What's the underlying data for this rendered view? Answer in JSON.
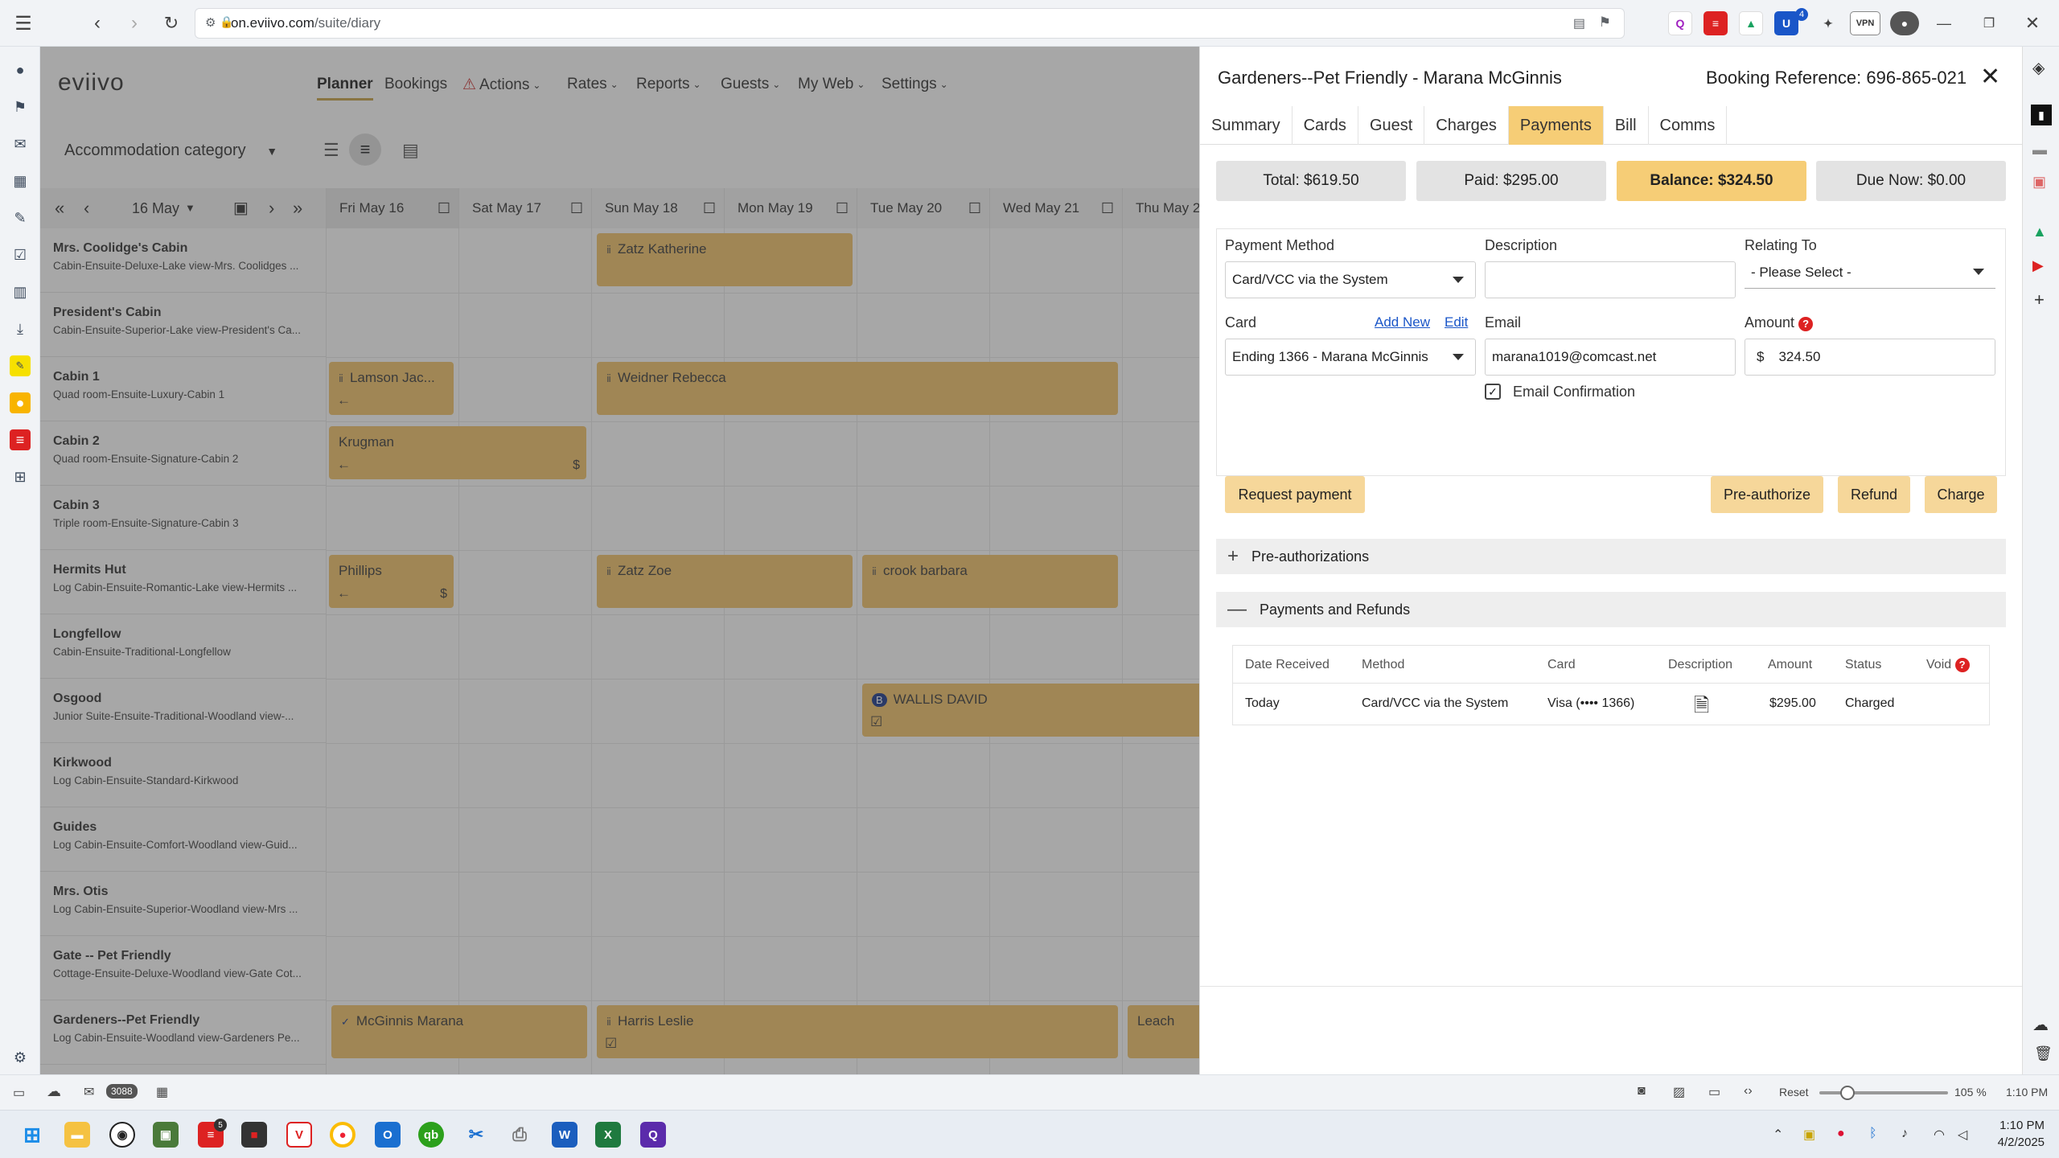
{
  "browser": {
    "url_host": "on.eviivo.com",
    "url_path": "/suite/diary",
    "vpn_label": "VPN",
    "badge_count": "4"
  },
  "app": {
    "logo": "eviivo",
    "nav": {
      "planner": "Planner",
      "bookings": "Bookings",
      "actions": "Actions",
      "rates": "Rates",
      "reports": "Reports",
      "guests": "Guests",
      "myweb": "My Web",
      "settings": "Settings"
    },
    "category_select": "Accommodation category",
    "date_select": "16 May",
    "days": [
      "Fri May 16",
      "Sat May 17",
      "Sun May 18",
      "Mon May 19",
      "Tue May 20",
      "Wed May 21",
      "Thu May 2"
    ],
    "rooms": [
      {
        "name": "Mrs. Coolidge's Cabin",
        "desc": "Cabin-Ensuite-Deluxe-Lake view-Mrs. Coolidges ..."
      },
      {
        "name": "President's Cabin",
        "desc": "Cabin-Ensuite-Superior-Lake view-President's Ca..."
      },
      {
        "name": "Cabin 1",
        "desc": "Quad room-Ensuite-Luxury-Cabin 1"
      },
      {
        "name": "Cabin 2",
        "desc": "Quad room-Ensuite-Signature-Cabin 2"
      },
      {
        "name": "Cabin 3",
        "desc": "Triple room-Ensuite-Signature-Cabin 3"
      },
      {
        "name": "Hermits Hut",
        "desc": "Log Cabin-Ensuite-Romantic-Lake view-Hermits ..."
      },
      {
        "name": "Longfellow",
        "desc": "Cabin-Ensuite-Traditional-Longfellow"
      },
      {
        "name": "Osgood",
        "desc": "Junior Suite-Ensuite-Traditional-Woodland view-..."
      },
      {
        "name": "Kirkwood",
        "desc": "Log Cabin-Ensuite-Standard-Kirkwood"
      },
      {
        "name": "Guides",
        "desc": "Log Cabin-Ensuite-Comfort-Woodland view-Guid..."
      },
      {
        "name": "Mrs. Otis",
        "desc": "Log Cabin-Ensuite-Superior-Woodland view-Mrs ..."
      },
      {
        "name": "Gate -- Pet Friendly",
        "desc": "Cottage-Ensuite-Deluxe-Woodland view-Gate Cot..."
      },
      {
        "name": "Gardeners--Pet Friendly",
        "desc": "Log Cabin-Ensuite-Woodland view-Gardeners Pe..."
      }
    ],
    "bookings": {
      "zatz_katherine": "Zatz Katherine",
      "lamson": "Lamson Jac...",
      "weidner": "Weidner Rebecca",
      "krugman": "Krugman",
      "phillips": "Phillips",
      "zatz_zoe": "Zatz Zoe",
      "crook": "crook barbara",
      "wallis": "WALLIS DAVID",
      "mcginnis": "McGinnis Marana",
      "harris": "Harris Leslie",
      "leach": "Leach"
    }
  },
  "panel": {
    "title": "Gardeners--Pet Friendly - Marana McGinnis",
    "booking_ref": "Booking Reference: 696-865-021",
    "tabs": [
      "Summary",
      "Cards",
      "Guest",
      "Charges",
      "Payments",
      "Bill",
      "Comms"
    ],
    "active_tab": "Payments",
    "total": "Total: $619.50",
    "paid": "Paid: $295.00",
    "balance": "Balance: $324.50",
    "due_now": "Due Now: $0.00",
    "form": {
      "payment_method_label": "Payment Method",
      "payment_method_value": "Card/VCC via the System",
      "description_label": "Description",
      "description_value": "",
      "relating_to_label": "Relating To",
      "relating_to_value": "- Please Select -",
      "card_label": "Card",
      "add_new": "Add New",
      "edit": "Edit",
      "card_value": "Ending 1366 - Marana McGinnis",
      "email_label": "Email",
      "email_value": "marana1019@comcast.net",
      "amount_label": "Amount",
      "currency_symbol": "$",
      "amount_value": "324.50",
      "email_confirmation": "Email Confirmation",
      "email_confirmation_checked": true
    },
    "buttons": {
      "request_payment": "Request payment",
      "pre_authorize": "Pre-authorize",
      "refund": "Refund",
      "charge": "Charge"
    },
    "preauth_section": "Pre-authorizations",
    "payments_section": "Payments and Refunds",
    "table": {
      "headers": [
        "Date Received",
        "Method",
        "Card",
        "Description",
        "Amount",
        "Status",
        "Void"
      ],
      "rows": [
        {
          "date": "Today",
          "method": "Card/VCC via the System",
          "card": "Visa (•••• 1366)",
          "amount": "$295.00",
          "status": "Charged"
        }
      ]
    }
  },
  "statusbar": {
    "mail_count": "3088",
    "reset": "Reset",
    "zoom": "105 %",
    "time": "1:10 PM"
  },
  "taskbar": {
    "time": "1:10 PM",
    "date": "4/2/2025",
    "mail_badge": "5"
  },
  "colors": {
    "booking": "#f3c46b",
    "active_tab": "#f6cd76",
    "balance": "#f6cd76",
    "button": "#f6d79a"
  }
}
